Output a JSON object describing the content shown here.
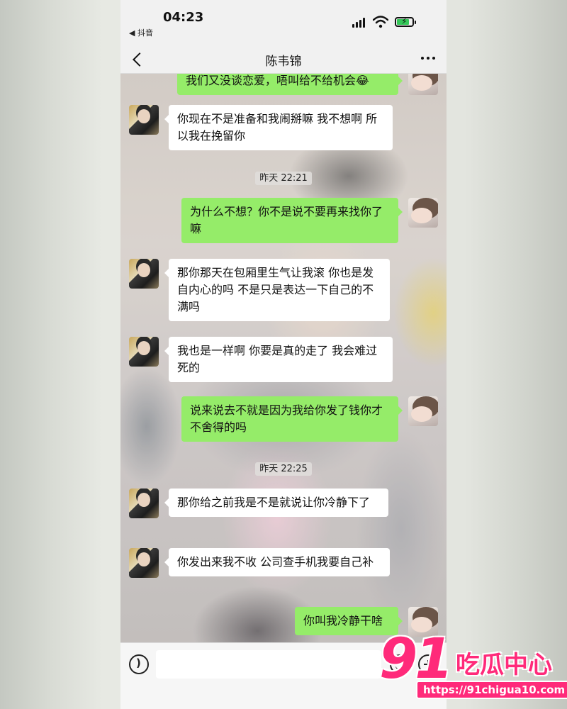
{
  "status_bar": {
    "time": "04:23",
    "back_app_label": "◀ 抖音"
  },
  "header": {
    "title": "陈韦锦"
  },
  "chat": {
    "messages": [
      {
        "side": "right",
        "text": "我们又没谈恋爱，唔叫给不给机会😂"
      },
      {
        "side": "left",
        "text": "你现在不是准备和我闹掰嘛 我不想啊 所以我在挽留你"
      },
      {
        "type": "time",
        "text": "昨天 22:21"
      },
      {
        "side": "right",
        "text": "为什么不想？你不是说不要再来找你了嘛"
      },
      {
        "side": "left",
        "text": "那你那天在包厢里生气让我滚 你也是发自内心的吗 不是只是表达一下自己的不满吗"
      },
      {
        "side": "left",
        "text": "我也是一样啊 你要是真的走了 我会难过死的"
      },
      {
        "side": "right",
        "text": "说来说去不就是因为我给你发了钱你才不舍得的吗"
      },
      {
        "type": "time",
        "text": "昨天 22:25"
      },
      {
        "side": "left",
        "text": "那你给之前我是不是就说让你冷静下了"
      },
      {
        "side": "left",
        "text": "你发出来我不收 公司查手机我要自己补"
      },
      {
        "side": "right",
        "text": "你叫我冷静干啥"
      }
    ]
  },
  "watermark": {
    "number": "91",
    "name": "吃瓜中心",
    "url": "https://91chigua10.com"
  },
  "colors": {
    "bubble_sent": "#95ec69",
    "bubble_received": "#ffffff",
    "watermark": "#ff2a7a"
  }
}
